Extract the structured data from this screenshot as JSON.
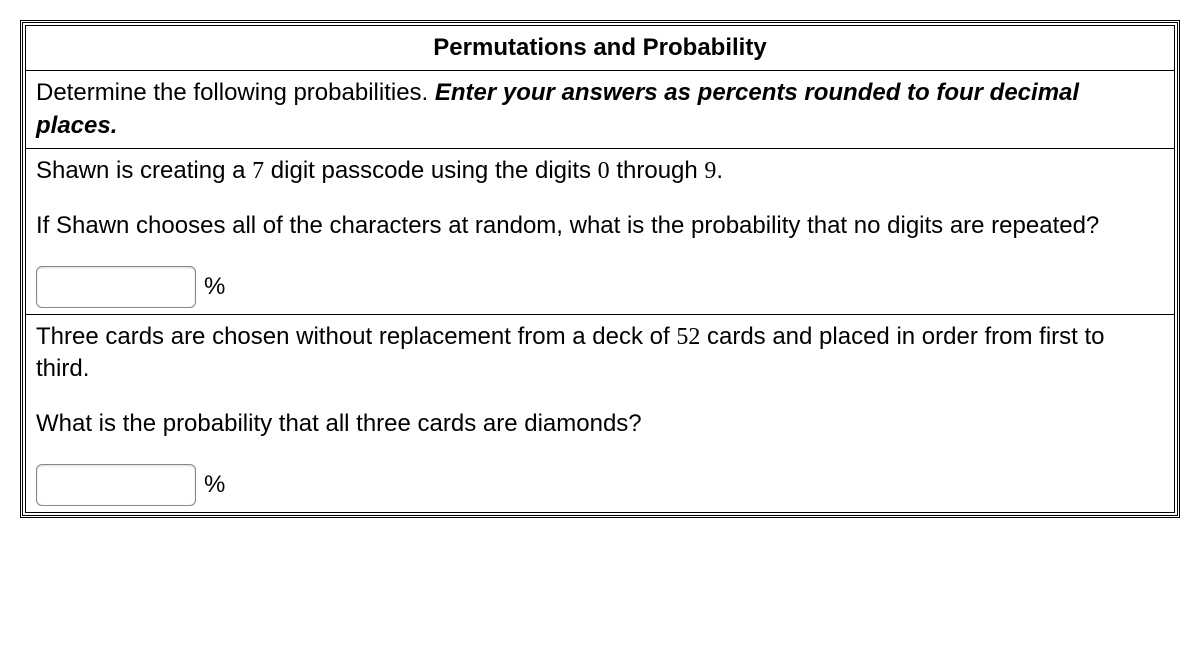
{
  "title": "Permutations and Probability",
  "instructions": {
    "lead": "Determine the following probabilities. ",
    "emph": "Enter your answers as percents rounded to four decimal places."
  },
  "q1": {
    "setup_pre": "Shawn is creating a ",
    "n_digits": "7",
    "setup_mid": " digit passcode using the digits ",
    "d_lo": "0",
    "setup_mid2": " through ",
    "d_hi": "9",
    "setup_post": ".",
    "prompt": "If Shawn chooses all of the characters at random, what is the probability that no digits are repeated?",
    "unit": "%"
  },
  "q2": {
    "setup_pre": "Three cards are chosen without replacement from a deck of ",
    "deck": "52",
    "setup_post": " cards and placed in order from first to third.",
    "prompt": "What is the probability that all three cards are diamonds?",
    "unit": "%"
  }
}
